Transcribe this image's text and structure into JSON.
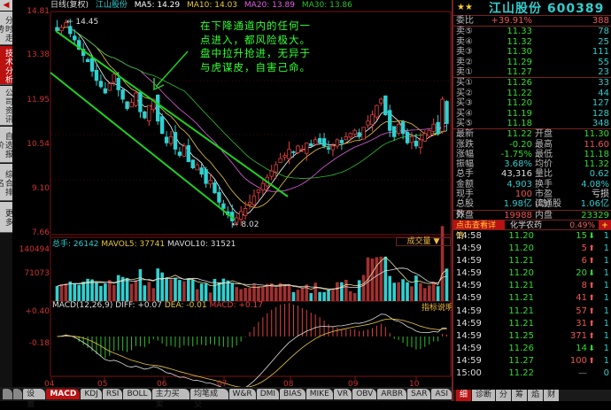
{
  "sidebar": {
    "tabs": [
      "分时走势",
      "技术分析",
      "公司资讯",
      "自选报价",
      "综合排名",
      "更多"
    ],
    "active": 1
  },
  "header": {
    "mode": "日线(复权)",
    "stock": "江山股份",
    "ma5": "MA5: 14.29",
    "ma10": "MA10: 14.03",
    "ma20": "MA20: 13.89",
    "ma30": "MA30: 13.86"
  },
  "colors": {
    "up": "#e04040",
    "down": "#30d0d0",
    "grid": "#7a1515",
    "ma5": "#ffffff",
    "ma10": "#e8c840",
    "ma20": "#e060e0",
    "ma30": "#30c030",
    "channel": "#20d020"
  },
  "price_axis": [
    "14.81",
    "13.38",
    "11.95",
    "10.54",
    "9.10",
    "7.66"
  ],
  "annotations": {
    "high": "14.45",
    "low": "8.02",
    "note": "在下降通道内的任何一点进入，都风险极大。盘中拉升抢进，无异于与虎谋皮，自害己命。"
  },
  "chart_data": {
    "type": "candlestick",
    "ylim": [
      7.66,
      14.81
    ],
    "closes": [
      14.2,
      14.3,
      14.45,
      14.1,
      13.9,
      13.6,
      13.4,
      13.2,
      12.9,
      12.6,
      12.4,
      12.2,
      12.5,
      12.8,
      12.3,
      12.0,
      11.7,
      11.9,
      12.2,
      11.6,
      11.4,
      11.8,
      12.0,
      11.3,
      10.9,
      10.6,
      10.8,
      10.4,
      10.2,
      10.5,
      10.0,
      9.8,
      9.9,
      9.6,
      9.3,
      9.4,
      9.0,
      8.7,
      8.5,
      8.3,
      8.1,
      8.2,
      8.4,
      8.5,
      8.7,
      8.9,
      9.1,
      9.3,
      9.5,
      9.7,
      9.9,
      10.1,
      10.2,
      10.4,
      10.3,
      10.5,
      10.4,
      10.6,
      10.5,
      10.7,
      10.6,
      10.5,
      10.4,
      10.5,
      10.7,
      10.6,
      10.8,
      10.9,
      11.0,
      10.8,
      11.1,
      11.3,
      11.5,
      11.8,
      12.0,
      11.5,
      11.0,
      10.8,
      11.2,
      10.9,
      10.6,
      10.8,
      10.5,
      10.7,
      10.9,
      11.0,
      11.2,
      10.9,
      12.0,
      11.22
    ],
    "vol_axis": [
      "140494",
      "71073"
    ],
    "vol_max": 140494,
    "macd_axis": [
      "+0.40",
      "-0.18"
    ],
    "dates": [
      "04",
      "05",
      "06",
      "07",
      "08",
      "09",
      "10"
    ]
  },
  "volume": {
    "header_total": "总手: 26142",
    "mavol5": "MAVOL5: 37741",
    "mavol10": "MAVOL10: 31521",
    "dropdown": "成交量 ▼"
  },
  "macd": {
    "title": "MACD(12,26,9)",
    "diff": "DIFF: +0.07",
    "dea": "DEA: -0.01",
    "macd": "MACD: +0.17",
    "explain": "指标说明"
  },
  "bottom_tabs": [
    "MACD",
    "KDJ",
    "RSI",
    "BOLL",
    "主力买卖",
    "均笔成交",
    "W&R",
    "DMI",
    "BIAS",
    "MIKE",
    "VR",
    "OBV",
    "ARBR",
    "SAR",
    "ASI"
  ],
  "bottom_settings": "设置",
  "quote": {
    "stars": "★★",
    "title": "江山股份 600389",
    "weibi": {
      "label": "委比",
      "pct": "+39.91%",
      "val": "388"
    },
    "sells": [
      {
        "l": "卖⑤",
        "p": "11.33",
        "v": "78"
      },
      {
        "l": "卖④",
        "p": "11.32",
        "v": "25"
      },
      {
        "l": "卖③",
        "p": "11.30",
        "v": "111"
      },
      {
        "l": "卖②",
        "p": "11.29",
        "v": "55"
      },
      {
        "l": "卖①",
        "p": "11.27",
        "v": "23"
      }
    ],
    "buys": [
      {
        "l": "买①",
        "p": "11.26",
        "v": "33"
      },
      {
        "l": "买②",
        "p": "11.22",
        "v": "44"
      },
      {
        "l": "买③",
        "p": "11.20",
        "v": "127"
      },
      {
        "l": "买④",
        "p": "11.19",
        "v": "128"
      },
      {
        "l": "买⑤",
        "p": "11.18",
        "v": "348"
      }
    ],
    "stats": [
      {
        "l": "最新",
        "a": "11.22",
        "ac": "#3d3",
        "l2": "开盘",
        "b": "11.30",
        "bc": "#3d3"
      },
      {
        "l": "涨跌",
        "a": "-0.20",
        "ac": "#3d3",
        "l2": "最高",
        "b": "11.60",
        "bc": "#e55"
      },
      {
        "l": "涨幅",
        "a": "-1.75%",
        "ac": "#3d3",
        "l2": "最低",
        "b": "11.18",
        "bc": "#3d3"
      },
      {
        "l": "振幅",
        "a": "3.68%",
        "ac": "#3cc",
        "l2": "均价",
        "b": "11.32",
        "bc": "#3d3"
      },
      {
        "l": "总手",
        "a": "43,316",
        "ac": "#ddd",
        "l2": "量比",
        "b": "0.62",
        "bc": "#3cc"
      },
      {
        "l": "金额",
        "a": "4,903",
        "ac": "#3cc",
        "l2": "换手",
        "b": "4.08%",
        "bc": "#3cc"
      },
      {
        "l": "现手",
        "a": "100",
        "ac": "#e55",
        "l2": "市盈(动)",
        "b": "亏损",
        "bc": "#ddd"
      },
      {
        "l": "总股数",
        "a": "1.98亿",
        "ac": "#3cc",
        "l2": "流通股",
        "b": "1.06亿",
        "bc": "#3cc"
      },
      {
        "l": "外盘",
        "a": "19988",
        "ac": "#e55",
        "l2": "内盘",
        "b": "23329",
        "bc": "#3d3"
      }
    ],
    "detail_button": "点击查看详情",
    "sector": "化学农药",
    "sector_pct": "0.49%",
    "plus": "+",
    "ticks": [
      {
        "t": "14:58",
        "p": "11.20",
        "q": "15",
        "d": "down",
        "n": "1"
      },
      {
        "t": "14:59",
        "p": "11.20",
        "q": "5",
        "d": "up",
        "n": "1"
      },
      {
        "t": "14:59",
        "p": "11.21",
        "q": "6",
        "d": "up",
        "n": "1"
      },
      {
        "t": "14:59",
        "p": "11.20",
        "q": "20",
        "d": "down",
        "n": "1"
      },
      {
        "t": "14:59",
        "p": "11.21",
        "q": "8",
        "d": "up",
        "n": "1"
      },
      {
        "t": "14:59",
        "p": "11.21",
        "q": "41",
        "d": "up",
        "n": "1"
      },
      {
        "t": "14:59",
        "p": "11.21",
        "q": "57",
        "d": "up",
        "n": "1"
      },
      {
        "t": "14:59",
        "p": "11.21",
        "q": "31",
        "d": "up",
        "n": "1"
      },
      {
        "t": "14:59",
        "p": "11.25",
        "q": "371",
        "d": "up",
        "n": "1"
      },
      {
        "t": "14:59",
        "p": "11.26",
        "q": "14",
        "d": "down",
        "n": "1"
      },
      {
        "t": "14:59",
        "p": "11.27",
        "q": "100",
        "d": "up",
        "n": "1"
      },
      {
        "t": "15:00",
        "p": "11.22",
        "q": "—",
        "d": "none",
        "n": "0"
      }
    ],
    "tabs": [
      "细",
      "诊断",
      "分",
      "筹",
      "焰",
      "财"
    ]
  }
}
